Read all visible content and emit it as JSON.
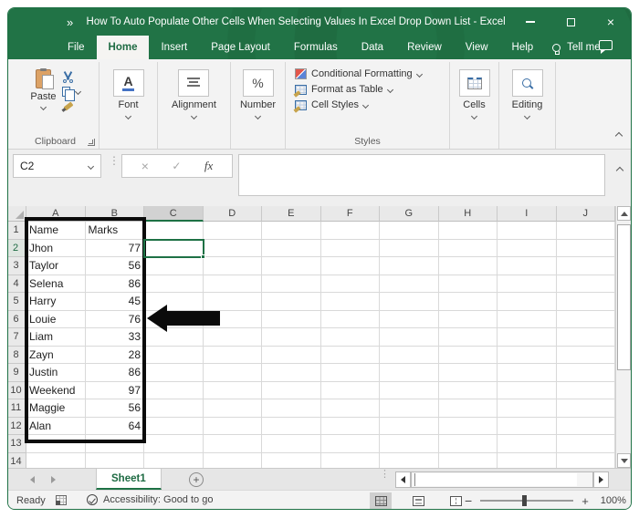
{
  "window": {
    "title": "How To Auto Populate Other Cells When Selecting Values In Excel Drop Down List - Excel",
    "quick_access": "»"
  },
  "menu": {
    "tabs": [
      "File",
      "Home",
      "Insert",
      "Page Layout",
      "Formulas",
      "Data",
      "Review",
      "View",
      "Help"
    ],
    "active_tab": "Home",
    "tell_me": "Tell me"
  },
  "ribbon": {
    "clipboard": {
      "paste": "Paste",
      "group_label": "Clipboard"
    },
    "font": {
      "label": "Font"
    },
    "alignment": {
      "label": "Alignment"
    },
    "number": {
      "label": "Number",
      "icon_text": "%"
    },
    "styles": {
      "items": [
        "Conditional Formatting",
        "Format as Table",
        "Cell Styles"
      ],
      "group_label": "Styles"
    },
    "cells": {
      "label": "Cells"
    },
    "editing": {
      "label": "Editing"
    }
  },
  "formula_bar": {
    "name_box_value": "C2",
    "fx_label": "fx",
    "formula_value": ""
  },
  "grid": {
    "column_headers": [
      "A",
      "B",
      "C",
      "D",
      "E",
      "F",
      "G",
      "H",
      "I",
      "J"
    ],
    "selected_cell": "C2",
    "selected_column": "C",
    "selected_row": 2,
    "rows": [
      {
        "row": 1,
        "A": "Name",
        "B": "Marks"
      },
      {
        "row": 2,
        "A": "Jhon",
        "B": "77"
      },
      {
        "row": 3,
        "A": "Taylor",
        "B": "56"
      },
      {
        "row": 4,
        "A": "Selena",
        "B": "86"
      },
      {
        "row": 5,
        "A": "Harry",
        "B": "45"
      },
      {
        "row": 6,
        "A": "Louie",
        "B": "76"
      },
      {
        "row": 7,
        "A": "Liam",
        "B": "33"
      },
      {
        "row": 8,
        "A": "Zayn",
        "B": "28"
      },
      {
        "row": 9,
        "A": "Justin",
        "B": "86"
      },
      {
        "row": 10,
        "A": "Weekend",
        "B": "97"
      },
      {
        "row": 11,
        "A": "Maggie",
        "B": "56"
      },
      {
        "row": 12,
        "A": "Alan",
        "B": "64"
      },
      {
        "row": 13,
        "A": "",
        "B": ""
      },
      {
        "row": 14,
        "A": "",
        "B": ""
      }
    ]
  },
  "sheet_bar": {
    "sheet_name": "Sheet1",
    "add_sheet": "+"
  },
  "status_bar": {
    "ready": "Ready",
    "accessibility": "Accessibility: Good to go",
    "zoom_level": "100%",
    "zoom_minus": "−",
    "zoom_plus": "+"
  },
  "colors": {
    "excel_green": "#217346",
    "selection_green": "#1e7145",
    "annotation_black": "#0b0b0b"
  }
}
